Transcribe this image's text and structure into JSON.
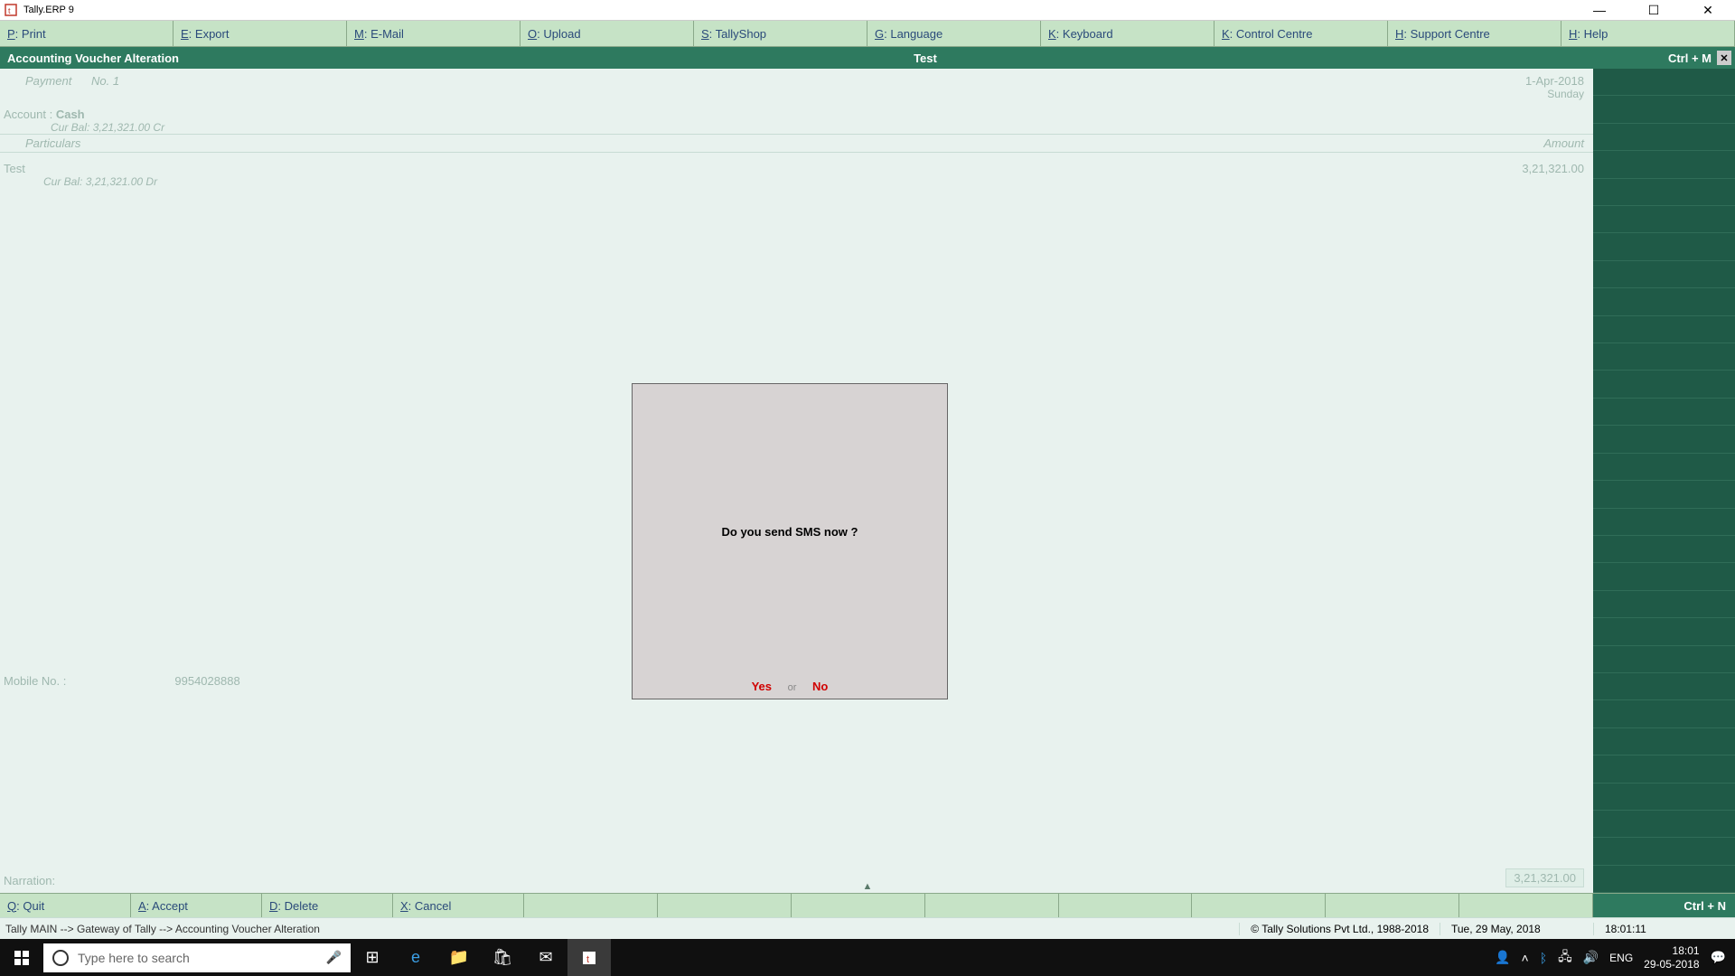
{
  "window": {
    "title": "Tally.ERP 9"
  },
  "topmenu": [
    {
      "key": "P",
      "label": ": Print"
    },
    {
      "key": "E",
      "label": ": Export"
    },
    {
      "key": "M",
      "label": ": E-Mail"
    },
    {
      "key": "O",
      "label": ": Upload"
    },
    {
      "key": "S",
      "label": ": TallyShop"
    },
    {
      "key": "G",
      "label": ": Language"
    },
    {
      "key": "K",
      "label": ": Keyboard"
    },
    {
      "key": "K",
      "label": ": Control Centre"
    },
    {
      "key": "H",
      "label": ": Support Centre"
    },
    {
      "key": "H",
      "label": ": Help"
    }
  ],
  "header": {
    "title": "Accounting Voucher  Alteration",
    "company": "Test",
    "shortcut": "Ctrl + M"
  },
  "voucher": {
    "type": "Payment",
    "no_label": "No. 1",
    "date": "1-Apr-2018",
    "day": "Sunday",
    "account_label": "Account :",
    "account": "Cash",
    "account_bal_label": "Cur Bal:",
    "account_bal": "3,21,321.00 Cr",
    "particulars_hdr": "Particulars",
    "amount_hdr": "Amount",
    "ledger": "Test",
    "ledger_bal_label": "Cur Bal:",
    "ledger_bal": "3,21,321.00 Dr",
    "amount": "3,21,321.00",
    "mobile_label": "Mobile No. :",
    "mobile": "9954028888",
    "narration_label": "Narration:",
    "total": "3,21,321.00"
  },
  "dialog": {
    "message": "Do you send SMS now ?",
    "yes": "Yes",
    "or": "or",
    "no": "No"
  },
  "bottom": {
    "quit": {
      "key": "Q",
      "label": ": Quit"
    },
    "accept": {
      "key": "A",
      "label": ": Accept"
    },
    "delete": {
      "key": "D",
      "label": ": Delete"
    },
    "cancel": {
      "key": "X",
      "label": ": Cancel"
    },
    "ctrln": "Ctrl + N"
  },
  "status": {
    "breadcrumb": "Tally MAIN --> Gateway of Tally --> Accounting Voucher  Alteration",
    "copyright": "© Tally Solutions Pvt Ltd., 1988-2018",
    "date": "Tue, 29 May, 2018",
    "time": "18:01:11"
  },
  "taskbar": {
    "search_placeholder": "Type here to search",
    "lang": "ENG",
    "clock_time": "18:01",
    "clock_date": "29-05-2018"
  }
}
